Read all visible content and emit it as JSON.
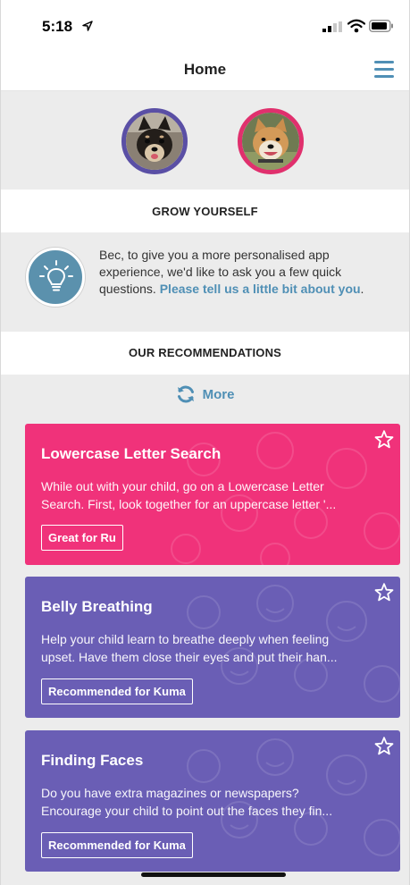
{
  "status_bar": {
    "time": "5:18"
  },
  "nav": {
    "title": "Home"
  },
  "sections": {
    "grow_title": "GROW YOURSELF",
    "recommendations_title": "OUR RECOMMENDATIONS"
  },
  "grow": {
    "text": "Bec, to give you a more personalised app experience, we'd like to ask you a few quick questions. ",
    "link": "Please tell us a little bit about you",
    "suffix": "."
  },
  "more": {
    "label": "More"
  },
  "cards": [
    {
      "title": "Lowercase Letter Search",
      "line1": "While out with your child, go on a Lowercase Letter",
      "line2": "Search. First, look together for an uppercase letter '...",
      "tag": "Great for Ru",
      "color": "#f0327a"
    },
    {
      "title": "Belly Breathing",
      "line1": "Help your child learn to breathe deeply when feeling",
      "line2": "upset. Have them close their eyes and put their han...",
      "tag": "Recommended for Kuma",
      "color": "#6a5eb5"
    },
    {
      "title": "Finding Faces",
      "line1": "Do you have extra magazines or newspapers?",
      "line2": "Encourage your child to point out the faces they fin...",
      "tag": "Recommended for Kuma",
      "color": "#6a5eb5"
    }
  ],
  "colors": {
    "accent": "#4f8fb5",
    "pink": "#f0327a",
    "purple": "#6a5eb5"
  },
  "icons": [
    "location-arrow-icon",
    "signal-icon",
    "wifi-icon",
    "battery-icon",
    "menu-icon",
    "lightbulb-icon",
    "refresh-icon",
    "star-icon"
  ]
}
